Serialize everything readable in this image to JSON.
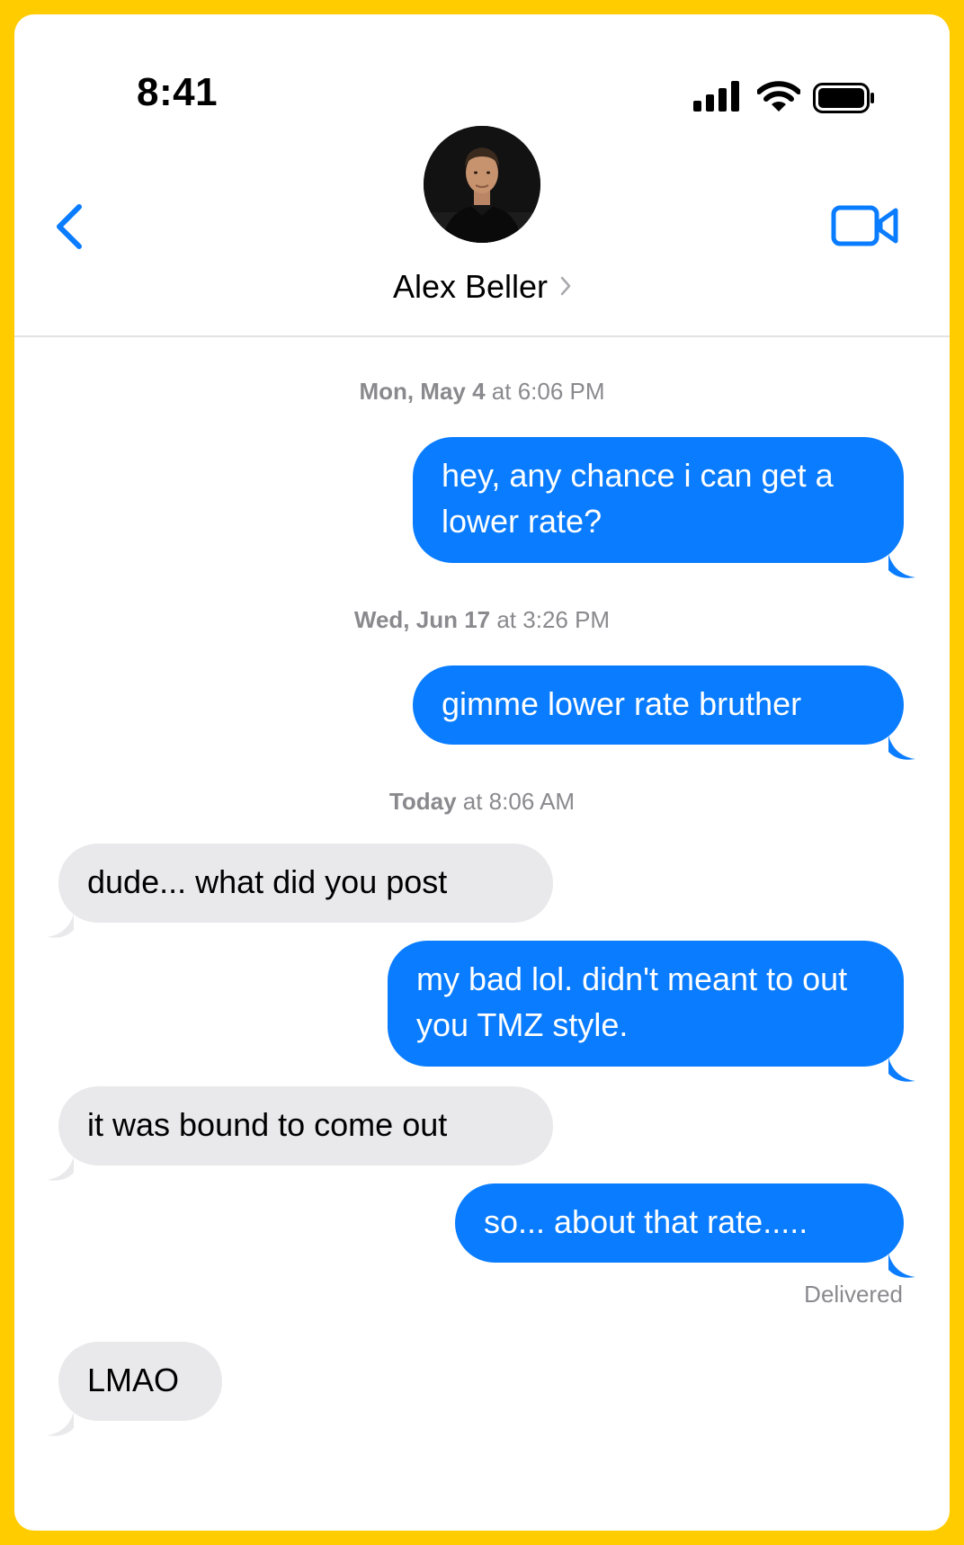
{
  "status_bar": {
    "time": "8:41"
  },
  "header": {
    "contact_name": "Alex Beller"
  },
  "messages": [
    {
      "type": "timestamp",
      "day": "Mon, May 4",
      "time": " at 6:06 PM"
    },
    {
      "type": "outgoing",
      "text": "hey, any chance i can get a lower rate?"
    },
    {
      "type": "timestamp",
      "day": "Wed, Jun 17",
      "time": " at 3:26 PM"
    },
    {
      "type": "outgoing",
      "text": "gimme lower rate bruther"
    },
    {
      "type": "timestamp",
      "day": "Today",
      "time": " at 8:06 AM"
    },
    {
      "type": "incoming",
      "text": "dude... what did you post"
    },
    {
      "type": "outgoing",
      "text": "my bad lol. didn't meant to out you TMZ style."
    },
    {
      "type": "incoming",
      "text": "it was bound to come out"
    },
    {
      "type": "outgoing",
      "text": "so... about that rate....."
    },
    {
      "type": "incoming",
      "text": "LMAO"
    }
  ],
  "delivery_status": "Delivered",
  "colors": {
    "frame": "#FFCC00",
    "outgoing_bubble": "#0A7CFF",
    "incoming_bubble": "#E9E9EB",
    "accent": "#0A7CFF",
    "timestamp_text": "#8A8A8E"
  },
  "icons": {
    "back": "chevron-left-icon",
    "video": "video-camera-icon",
    "signal": "cellular-signal-icon",
    "wifi": "wifi-icon",
    "battery": "battery-icon",
    "contact_chevron": "chevron-right-icon"
  }
}
